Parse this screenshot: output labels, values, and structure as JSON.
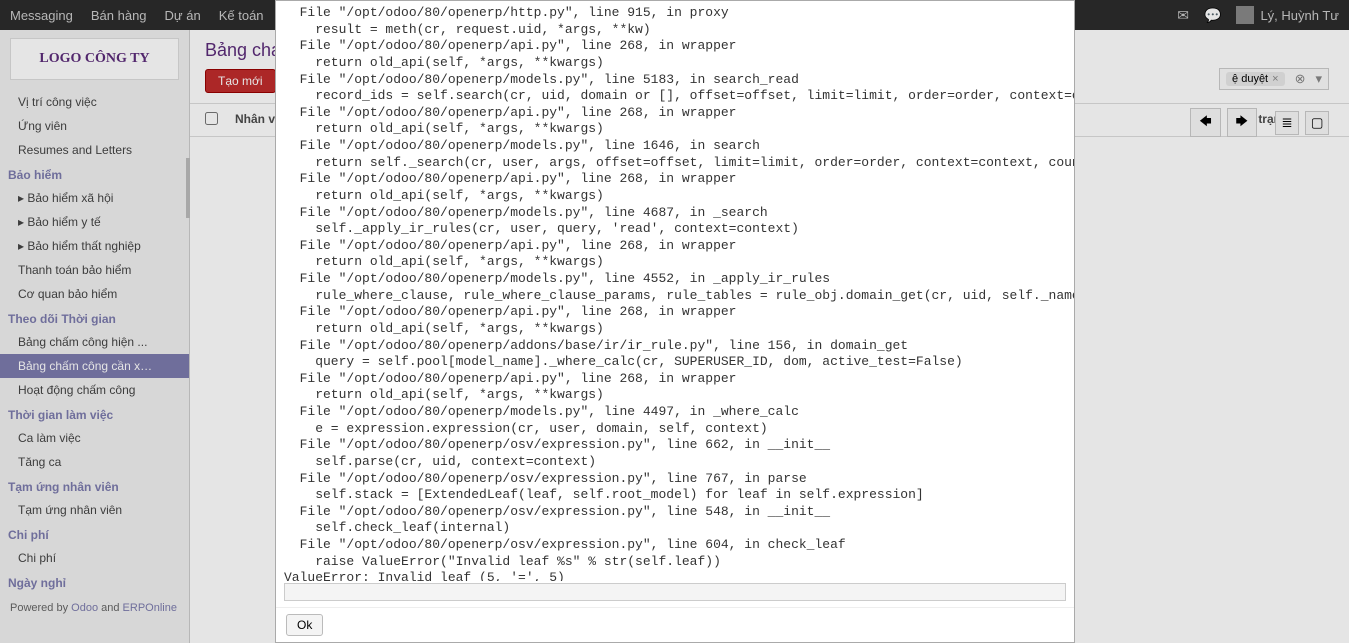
{
  "topnav": {
    "items": [
      "Messaging",
      "Bán hàng",
      "Dự án",
      "Kế toán"
    ],
    "user": "Lý, Huỳnh Tư"
  },
  "logo": "LOGO CÔNG TY",
  "sidebar": {
    "groups": [
      {
        "items": [
          "Vị trí công việc",
          "Ứng viên",
          "Resumes and Letters"
        ]
      },
      {
        "title": "Bảo hiểm",
        "items": [
          "Bảo hiểm xã hội",
          "Bảo hiểm y tế",
          "Bảo hiểm thất nghiệp",
          "Thanh toán bảo hiểm",
          "Cơ quan bảo hiểm"
        ]
      },
      {
        "title": "Theo dõi Thời gian",
        "items": [
          "Bảng chấm công hiện ...",
          "Bảng chấm công cần x…",
          "Hoạt động chấm công"
        ]
      },
      {
        "title": "Thời gian làm việc",
        "items": [
          "Ca làm việc",
          "Tăng ca"
        ]
      },
      {
        "title": "Tạm ứng nhân viên",
        "items": [
          "Tạm ứng nhân viên"
        ]
      },
      {
        "title": "Chi phí",
        "items": [
          "Chi phí"
        ]
      },
      {
        "title": "Ngày nghỉ",
        "items": []
      }
    ],
    "active": "Bảng chấm công cần x…"
  },
  "footer": {
    "prefix": "Powered by ",
    "a1": "Odoo",
    "mid": " and ",
    "a2": "ERPOnline"
  },
  "content": {
    "title": "Bảng cha",
    "new_btn": "Tạo mới",
    "filter_tag": "ệ duyệt",
    "columns": {
      "nv": "Nhân v",
      "status": "Tình trạng"
    }
  },
  "modal": {
    "ok": "Ok",
    "traceback": "  File \"/opt/odoo/80/openerp/http.py\", line 915, in proxy\n    result = meth(cr, request.uid, *args, **kw)\n  File \"/opt/odoo/80/openerp/api.py\", line 268, in wrapper\n    return old_api(self, *args, **kwargs)\n  File \"/opt/odoo/80/openerp/models.py\", line 5183, in search_read\n    record_ids = self.search(cr, uid, domain or [], offset=offset, limit=limit, order=order, context=context)\n  File \"/opt/odoo/80/openerp/api.py\", line 268, in wrapper\n    return old_api(self, *args, **kwargs)\n  File \"/opt/odoo/80/openerp/models.py\", line 1646, in search\n    return self._search(cr, user, args, offset=offset, limit=limit, order=order, context=context, count=count)\n  File \"/opt/odoo/80/openerp/api.py\", line 268, in wrapper\n    return old_api(self, *args, **kwargs)\n  File \"/opt/odoo/80/openerp/models.py\", line 4687, in _search\n    self._apply_ir_rules(cr, user, query, 'read', context=context)\n  File \"/opt/odoo/80/openerp/api.py\", line 268, in wrapper\n    return old_api(self, *args, **kwargs)\n  File \"/opt/odoo/80/openerp/models.py\", line 4552, in _apply_ir_rules\n    rule_where_clause, rule_where_clause_params, rule_tables = rule_obj.domain_get(cr, uid, self._name, mode, c\n  File \"/opt/odoo/80/openerp/api.py\", line 268, in wrapper\n    return old_api(self, *args, **kwargs)\n  File \"/opt/odoo/80/openerp/addons/base/ir/ir_rule.py\", line 156, in domain_get\n    query = self.pool[model_name]._where_calc(cr, SUPERUSER_ID, dom, active_test=False)\n  File \"/opt/odoo/80/openerp/api.py\", line 268, in wrapper\n    return old_api(self, *args, **kwargs)\n  File \"/opt/odoo/80/openerp/models.py\", line 4497, in _where_calc\n    e = expression.expression(cr, user, domain, self, context)\n  File \"/opt/odoo/80/openerp/osv/expression.py\", line 662, in __init__\n    self.parse(cr, uid, context=context)\n  File \"/opt/odoo/80/openerp/osv/expression.py\", line 767, in parse\n    self.stack = [ExtendedLeaf(leaf, self.root_model) for leaf in self.expression]\n  File \"/opt/odoo/80/openerp/osv/expression.py\", line 548, in __init__\n    self.check_leaf(internal)\n  File \"/opt/odoo/80/openerp/osv/expression.py\", line 604, in check_leaf\n    raise ValueError(\"Invalid leaf %s\" % str(self.leaf))\nValueError: Invalid leaf (5, '=', 5)"
  }
}
